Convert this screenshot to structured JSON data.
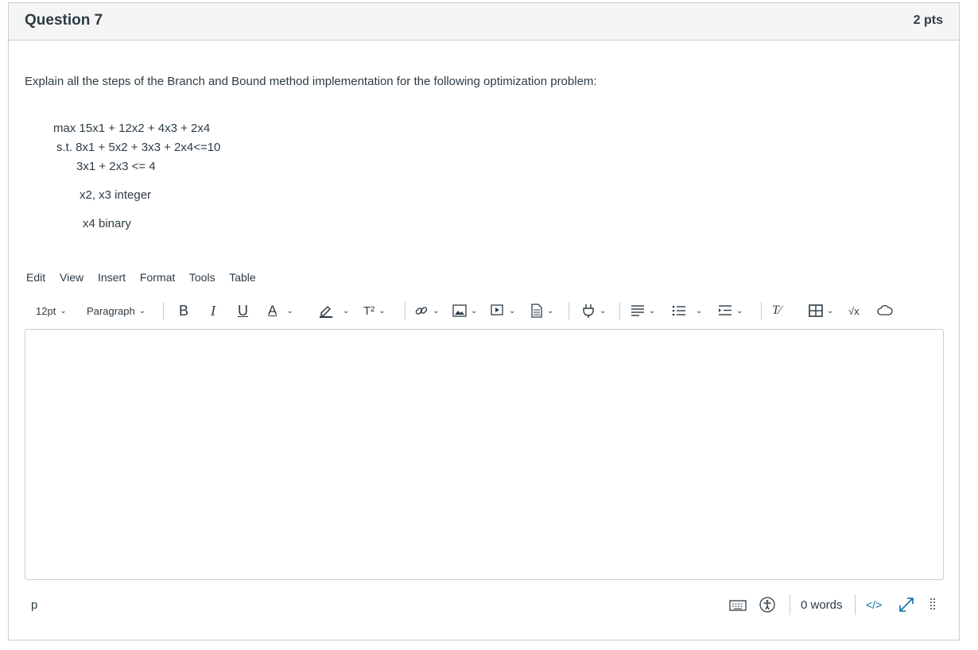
{
  "question": {
    "title": "Question 7",
    "points": "2 pts",
    "prompt": "Explain all the steps of the Branch and Bound method implementation for the following optimization problem:",
    "lines": [
      "max 15x1 + 12x2 + 4x3 + 2x4",
      "s.t. 8x1 + 5x2 + 3x3 + 2x4<=10",
      "3x1 + 2x3 <= 4",
      "x2, x3 integer",
      "x4 binary"
    ]
  },
  "menubar": [
    "Edit",
    "View",
    "Insert",
    "Format",
    "Tools",
    "Table"
  ],
  "toolbar": {
    "font_size": "12pt",
    "block_format": "Paragraph",
    "bold": "B",
    "italic": "I",
    "underline": "U",
    "text_color": "A",
    "superscript": "T²",
    "math": "√x"
  },
  "status": {
    "element_path": "p",
    "word_count": "0 words",
    "html_toggle": "</>"
  },
  "colors": {
    "border": "#c7cdd1",
    "header_bg": "#f5f5f5",
    "text": "#2d3b45",
    "link": "#0770a3"
  }
}
